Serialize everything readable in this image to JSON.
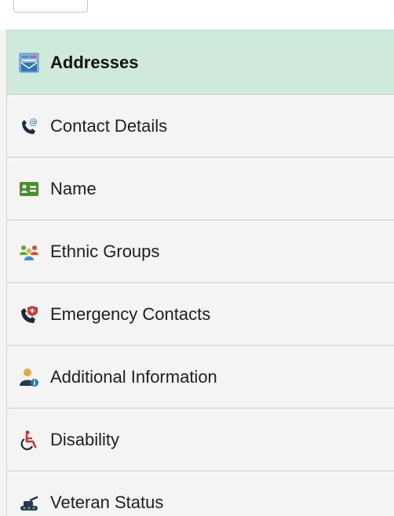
{
  "nav": {
    "items": [
      {
        "label": "Addresses",
        "icon": "envelope-map-icon",
        "selected": true
      },
      {
        "label": "Contact Details",
        "icon": "phone-at-icon",
        "selected": false
      },
      {
        "label": "Name",
        "icon": "id-card-icon",
        "selected": false
      },
      {
        "label": "Ethnic Groups",
        "icon": "people-group-icon",
        "selected": false
      },
      {
        "label": "Emergency Contacts",
        "icon": "phone-emergency-icon",
        "selected": false
      },
      {
        "label": "Additional Information",
        "icon": "person-info-icon",
        "selected": false
      },
      {
        "label": "Disability",
        "icon": "wheelchair-icon",
        "selected": false
      },
      {
        "label": "Veteran Status",
        "icon": "veteran-icon",
        "selected": false
      }
    ]
  },
  "colors": {
    "selected_bg": "#cfeadb",
    "item_bg": "#f4f4f4",
    "divider": "#cfcfcf",
    "text": "#1f1f1f",
    "icon_dark": "#233a4e",
    "icon_blue": "#3b8fd6",
    "icon_green": "#4a8f2b",
    "icon_orange": "#e58b2c",
    "icon_red": "#d23a3a"
  }
}
